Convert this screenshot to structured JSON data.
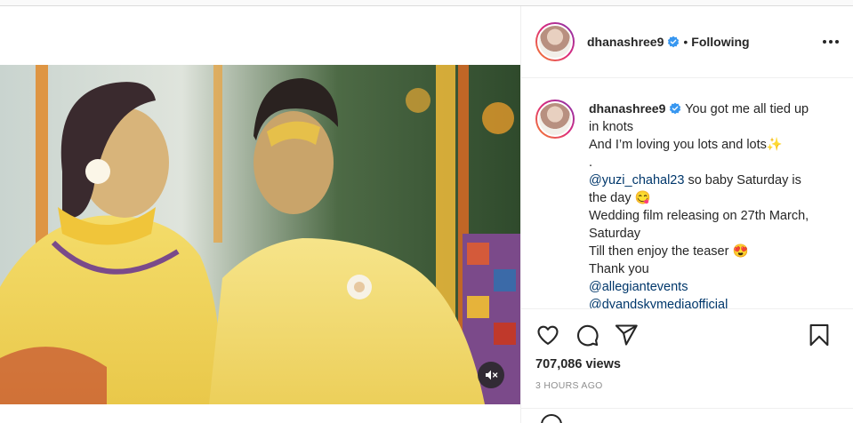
{
  "post": {
    "username": "dhanashree9",
    "follow_separator": "•",
    "follow_status": "Following",
    "caption": {
      "lines": [
        "You got me all tied up in knots",
        "And I’m loving you lots and lots✨",
        ".",
        "@yuzi_chahal23 so baby Saturday is the day 😋",
        "Wedding film releasing on 27th March, Saturday",
        "Till then enjoy the teaser 😍",
        "Thank you",
        "@allegiantevents",
        "@dyandskymediaofficial"
      ]
    },
    "views": "707,086 views",
    "timestamp": "3 HOURS AGO"
  },
  "icons": {
    "verified": "verified-badge-icon",
    "more": "more-options-icon",
    "like": "heart-icon",
    "comment": "comment-icon",
    "share": "paper-plane-icon",
    "save": "bookmark-icon",
    "mute": "muted-speaker-icon"
  },
  "colors": {
    "verified_blue": "#3897f0",
    "link": "#00376b",
    "secondary_text": "#8e8e8e",
    "border": "#efefef"
  }
}
